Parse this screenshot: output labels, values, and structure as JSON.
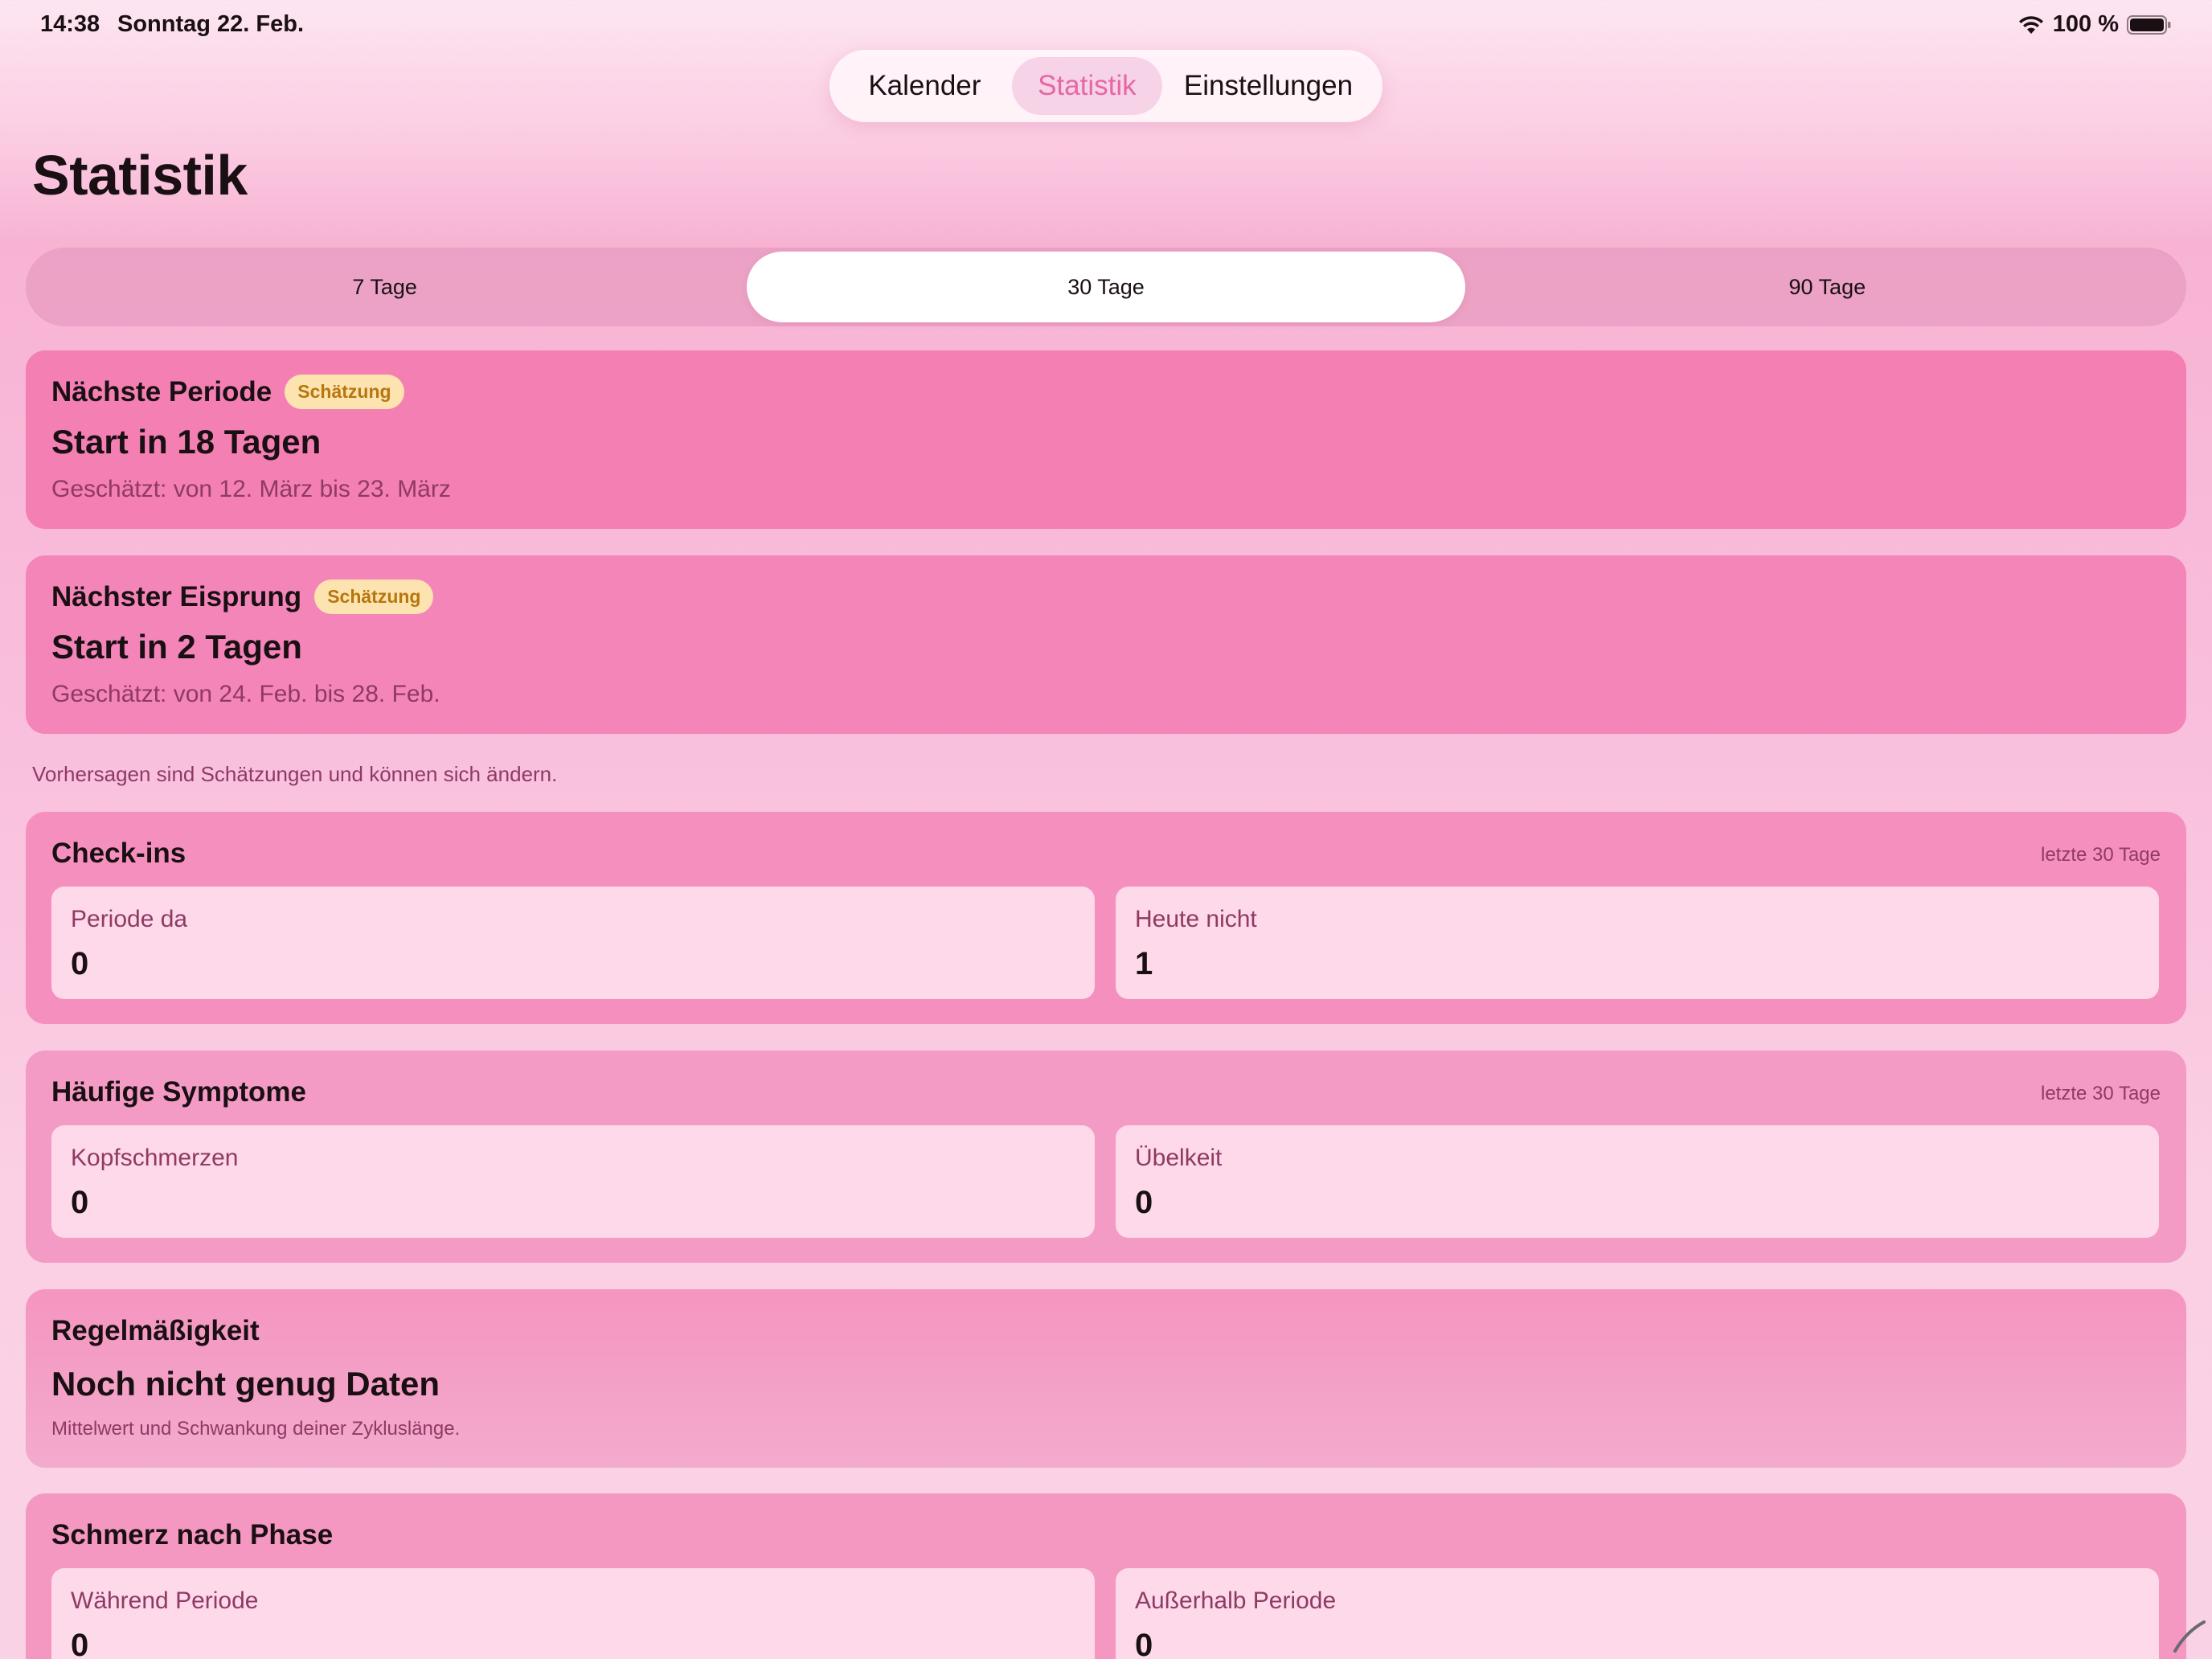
{
  "status_bar": {
    "time": "14:38",
    "date": "Sonntag 22. Feb.",
    "battery": "100 %"
  },
  "nav": {
    "tabs": [
      {
        "label": "Kalender"
      },
      {
        "label": "Statistik",
        "selected": true
      },
      {
        "label": "Einstellungen"
      }
    ]
  },
  "page": {
    "title": "Statistik"
  },
  "range": {
    "options": [
      {
        "label": "7 Tage"
      },
      {
        "label": "30 Tage",
        "selected": true
      },
      {
        "label": "90 Tage"
      }
    ]
  },
  "next_period": {
    "title": "Nächste Periode",
    "badge": "Schätzung",
    "headline": "Start in 18 Tagen",
    "detail": "Geschätzt: von 12. März bis 23. März"
  },
  "next_ovulation": {
    "title": "Nächster Eisprung",
    "badge": "Schätzung",
    "headline": "Start in 2 Tagen",
    "detail": "Geschätzt: von 24. Feb. bis 28. Feb."
  },
  "disclaimer": "Vorhersagen sind Schätzungen und können sich ändern.",
  "checkins": {
    "title": "Check-ins",
    "period": "letzte 30 Tage",
    "items": [
      {
        "label": "Periode da",
        "value": "0"
      },
      {
        "label": "Heute nicht",
        "value": "1"
      }
    ]
  },
  "symptoms": {
    "title": "Häufige Symptome",
    "period": "letzte 30 Tage",
    "items": [
      {
        "label": "Kopfschmerzen",
        "value": "0"
      },
      {
        "label": "Übelkeit",
        "value": "0"
      }
    ]
  },
  "regularity": {
    "title": "Regelmäßigkeit",
    "headline": "Noch nicht genug Daten",
    "note": "Mittelwert und Schwankung deiner Zykluslänge."
  },
  "pain": {
    "title": "Schmerz nach Phase",
    "items": [
      {
        "label": "Während Periode",
        "value": "0"
      },
      {
        "label": "Außerhalb Periode",
        "value": "0"
      }
    ]
  },
  "colors": {
    "accent": "#e667a6",
    "badge_bg": "#fde3b0",
    "badge_text": "#b5770e"
  }
}
